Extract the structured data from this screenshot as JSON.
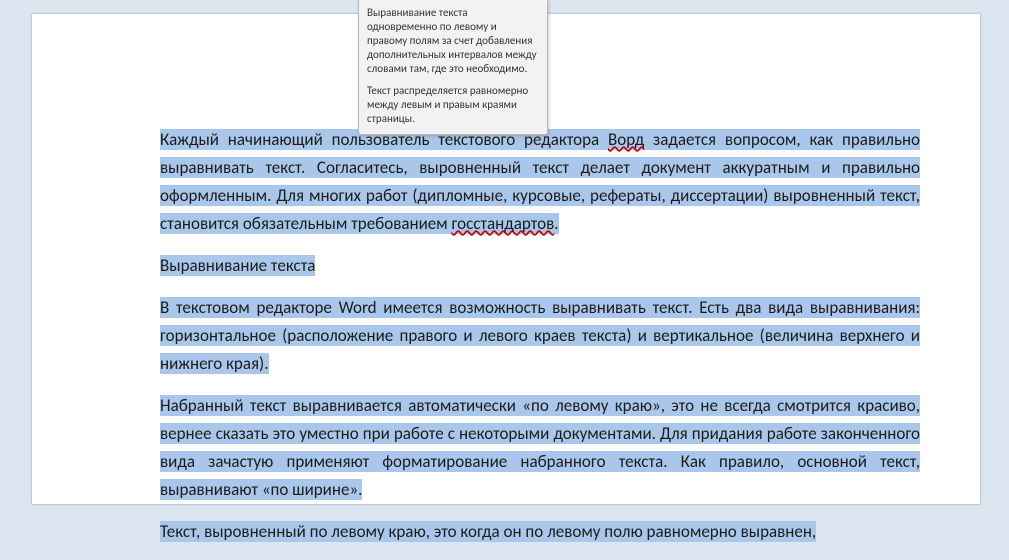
{
  "tooltip": {
    "p1": "Выравнивание текста одновременно по левому и правому полям за счет добавления дополнительных интервалов между словами там, где это необходимо.",
    "p2": "Текст распределяется равномерно между левым и правым краями страницы."
  },
  "doc": {
    "p1_a": "Каждый начинающий пользователь текстового редактора ",
    "p1_word": "Ворд",
    "p1_b": " задается вопросом, как правильно выравнивать текст. Согласитесь, выровненный текст делает документ аккуратным и правильно оформленным. Для многих работ (дипломные, курсовые, рефераты, диссертации) выровненный текст, становится обязательным требованием ",
    "p1_gost": "госстандартов",
    "p1_c": ".",
    "p2": "Выравнивание текста",
    "p3": "В текстовом редакторе Word имеется возможность выравнивать текст. Есть два вида выравнивания: горизонтальное (расположение правого и левого краев текста) и вертикальное (величина верхнего и нижнего края).",
    "p4": "Набранный текст выравнивается автоматически «по левому краю», это не всегда смотрится красиво, вернее сказать это уместно при работе с некоторыми документами. Для придания работе законченного вида зачастую применяют форматирование набранного текста. Как правило, основной текст, выравнивают «по ширине».",
    "p5": "Текст, выровненный по левому краю, это когда он по левому полю равномерно выравнен,"
  }
}
